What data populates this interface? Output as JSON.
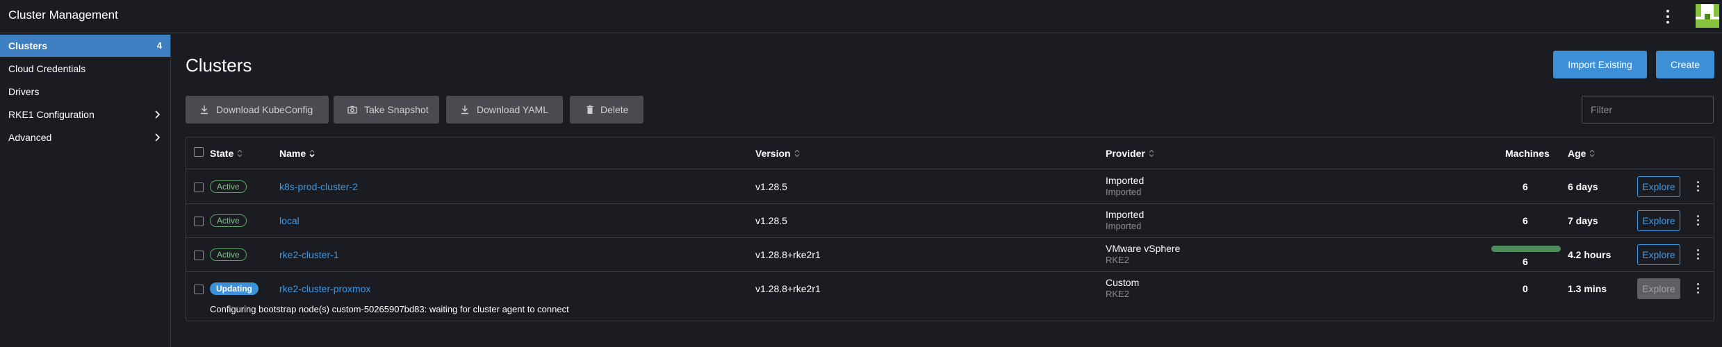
{
  "header": {
    "title": "Cluster Management"
  },
  "sidebar": {
    "items": [
      {
        "label": "Clusters",
        "count": "4"
      },
      {
        "label": "Cloud Credentials"
      },
      {
        "label": "Drivers"
      },
      {
        "label": "RKE1 Configuration"
      },
      {
        "label": "Advanced"
      }
    ]
  },
  "main": {
    "title": "Clusters",
    "import_label": "Import Existing",
    "create_label": "Create",
    "bulk_actions": [
      {
        "label": "Download KubeConfig",
        "icon": "download-icon"
      },
      {
        "label": "Take Snapshot",
        "icon": "camera-icon"
      },
      {
        "label": "Download YAML",
        "icon": "download-icon"
      },
      {
        "label": "Delete",
        "icon": "trash-icon"
      }
    ],
    "filter_placeholder": "Filter"
  },
  "table": {
    "columns": {
      "state": "State",
      "name": "Name",
      "version": "Version",
      "provider": "Provider",
      "machines": "Machines",
      "age": "Age"
    },
    "explore_label": "Explore",
    "rows": [
      {
        "state": "Active",
        "name": "k8s-prod-cluster-2",
        "version": "v1.28.5",
        "provider": "Imported",
        "provider_sub": "Imported",
        "machines": "6",
        "age": "6 days"
      },
      {
        "state": "Active",
        "name": "local",
        "version": "v1.28.5",
        "provider": "Imported",
        "provider_sub": "Imported",
        "machines": "6",
        "age": "7 days"
      },
      {
        "state": "Active",
        "name": "rke2-cluster-1",
        "version": "v1.28.8+rke2r1",
        "provider": "VMware vSphere",
        "provider_sub": "RKE2",
        "machines": "6",
        "machines_progress": 1.0,
        "age": "4.2 hours"
      },
      {
        "state": "Updating",
        "name": "rke2-cluster-proxmox",
        "version": "v1.28.8+rke2r1",
        "provider": "Custom",
        "provider_sub": "RKE2",
        "machines": "0",
        "age": "1.3 mins",
        "message": "Configuring bootstrap node(s) custom-50265907bd83: waiting for cluster agent to connect"
      }
    ]
  },
  "colors": {
    "accent": "#3d8fd6",
    "active_nav": "#3d7fc1",
    "active_badge": "#7ec889",
    "background": "#1b1c21"
  }
}
